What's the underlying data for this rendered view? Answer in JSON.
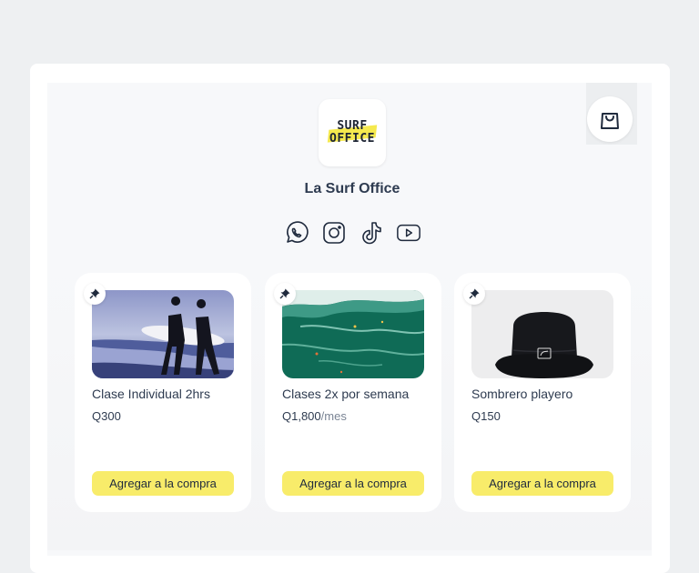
{
  "store": {
    "name": "La Surf Office",
    "logo_line1": "SURF",
    "logo_line2": "OFFICE"
  },
  "socials": [
    "whatsapp-icon",
    "instagram-icon",
    "tiktok-icon",
    "youtube-icon"
  ],
  "products": [
    {
      "name": "Clase Individual 2hrs",
      "price": "Q300",
      "period": "",
      "button": "Agregar a la compra"
    },
    {
      "name": "Clases 2x por semana",
      "price": "Q1,800",
      "period": "/mes",
      "button": "Agregar a la compra"
    },
    {
      "name": "Sombrero playero",
      "price": "Q150",
      "period": "",
      "button": "Agregar a la compra"
    }
  ],
  "colors": {
    "accent": "#f8ec6a",
    "text": "#2e3b50",
    "muted": "#7b8595"
  }
}
